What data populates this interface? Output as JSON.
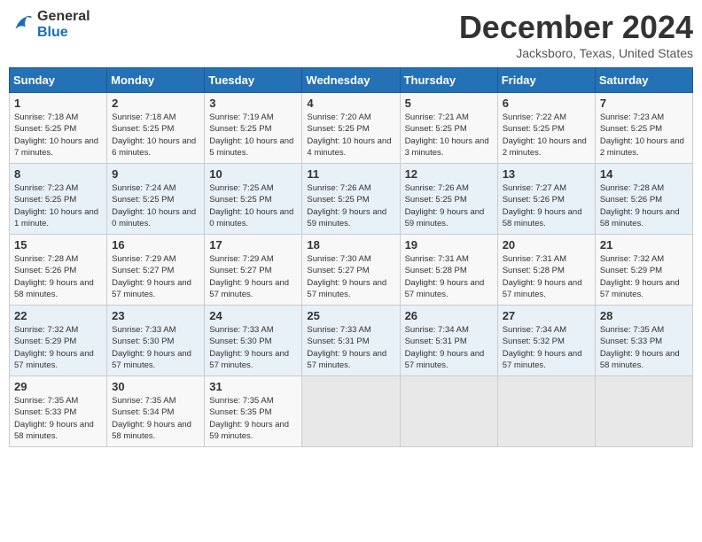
{
  "header": {
    "logo_line1": "General",
    "logo_line2": "Blue",
    "month": "December 2024",
    "location": "Jacksboro, Texas, United States"
  },
  "days_of_week": [
    "Sunday",
    "Monday",
    "Tuesday",
    "Wednesday",
    "Thursday",
    "Friday",
    "Saturday"
  ],
  "weeks": [
    [
      {
        "day": "1",
        "sunrise": "7:18 AM",
        "sunset": "5:25 PM",
        "daylight": "10 hours and 7 minutes."
      },
      {
        "day": "2",
        "sunrise": "7:18 AM",
        "sunset": "5:25 PM",
        "daylight": "10 hours and 6 minutes."
      },
      {
        "day": "3",
        "sunrise": "7:19 AM",
        "sunset": "5:25 PM",
        "daylight": "10 hours and 5 minutes."
      },
      {
        "day": "4",
        "sunrise": "7:20 AM",
        "sunset": "5:25 PM",
        "daylight": "10 hours and 4 minutes."
      },
      {
        "day": "5",
        "sunrise": "7:21 AM",
        "sunset": "5:25 PM",
        "daylight": "10 hours and 3 minutes."
      },
      {
        "day": "6",
        "sunrise": "7:22 AM",
        "sunset": "5:25 PM",
        "daylight": "10 hours and 2 minutes."
      },
      {
        "day": "7",
        "sunrise": "7:23 AM",
        "sunset": "5:25 PM",
        "daylight": "10 hours and 2 minutes."
      }
    ],
    [
      {
        "day": "8",
        "sunrise": "7:23 AM",
        "sunset": "5:25 PM",
        "daylight": "10 hours and 1 minute."
      },
      {
        "day": "9",
        "sunrise": "7:24 AM",
        "sunset": "5:25 PM",
        "daylight": "10 hours and 0 minutes."
      },
      {
        "day": "10",
        "sunrise": "7:25 AM",
        "sunset": "5:25 PM",
        "daylight": "10 hours and 0 minutes."
      },
      {
        "day": "11",
        "sunrise": "7:26 AM",
        "sunset": "5:25 PM",
        "daylight": "9 hours and 59 minutes."
      },
      {
        "day": "12",
        "sunrise": "7:26 AM",
        "sunset": "5:25 PM",
        "daylight": "9 hours and 59 minutes."
      },
      {
        "day": "13",
        "sunrise": "7:27 AM",
        "sunset": "5:26 PM",
        "daylight": "9 hours and 58 minutes."
      },
      {
        "day": "14",
        "sunrise": "7:28 AM",
        "sunset": "5:26 PM",
        "daylight": "9 hours and 58 minutes."
      }
    ],
    [
      {
        "day": "15",
        "sunrise": "7:28 AM",
        "sunset": "5:26 PM",
        "daylight": "9 hours and 58 minutes."
      },
      {
        "day": "16",
        "sunrise": "7:29 AM",
        "sunset": "5:27 PM",
        "daylight": "9 hours and 57 minutes."
      },
      {
        "day": "17",
        "sunrise": "7:29 AM",
        "sunset": "5:27 PM",
        "daylight": "9 hours and 57 minutes."
      },
      {
        "day": "18",
        "sunrise": "7:30 AM",
        "sunset": "5:27 PM",
        "daylight": "9 hours and 57 minutes."
      },
      {
        "day": "19",
        "sunrise": "7:31 AM",
        "sunset": "5:28 PM",
        "daylight": "9 hours and 57 minutes."
      },
      {
        "day": "20",
        "sunrise": "7:31 AM",
        "sunset": "5:28 PM",
        "daylight": "9 hours and 57 minutes."
      },
      {
        "day": "21",
        "sunrise": "7:32 AM",
        "sunset": "5:29 PM",
        "daylight": "9 hours and 57 minutes."
      }
    ],
    [
      {
        "day": "22",
        "sunrise": "7:32 AM",
        "sunset": "5:29 PM",
        "daylight": "9 hours and 57 minutes."
      },
      {
        "day": "23",
        "sunrise": "7:33 AM",
        "sunset": "5:30 PM",
        "daylight": "9 hours and 57 minutes."
      },
      {
        "day": "24",
        "sunrise": "7:33 AM",
        "sunset": "5:30 PM",
        "daylight": "9 hours and 57 minutes."
      },
      {
        "day": "25",
        "sunrise": "7:33 AM",
        "sunset": "5:31 PM",
        "daylight": "9 hours and 57 minutes."
      },
      {
        "day": "26",
        "sunrise": "7:34 AM",
        "sunset": "5:31 PM",
        "daylight": "9 hours and 57 minutes."
      },
      {
        "day": "27",
        "sunrise": "7:34 AM",
        "sunset": "5:32 PM",
        "daylight": "9 hours and 57 minutes."
      },
      {
        "day": "28",
        "sunrise": "7:35 AM",
        "sunset": "5:33 PM",
        "daylight": "9 hours and 58 minutes."
      }
    ],
    [
      {
        "day": "29",
        "sunrise": "7:35 AM",
        "sunset": "5:33 PM",
        "daylight": "9 hours and 58 minutes."
      },
      {
        "day": "30",
        "sunrise": "7:35 AM",
        "sunset": "5:34 PM",
        "daylight": "9 hours and 58 minutes."
      },
      {
        "day": "31",
        "sunrise": "7:35 AM",
        "sunset": "5:35 PM",
        "daylight": "9 hours and 59 minutes."
      },
      null,
      null,
      null,
      null
    ]
  ],
  "labels": {
    "sunrise": "Sunrise:",
    "sunset": "Sunset:",
    "daylight": "Daylight:"
  }
}
